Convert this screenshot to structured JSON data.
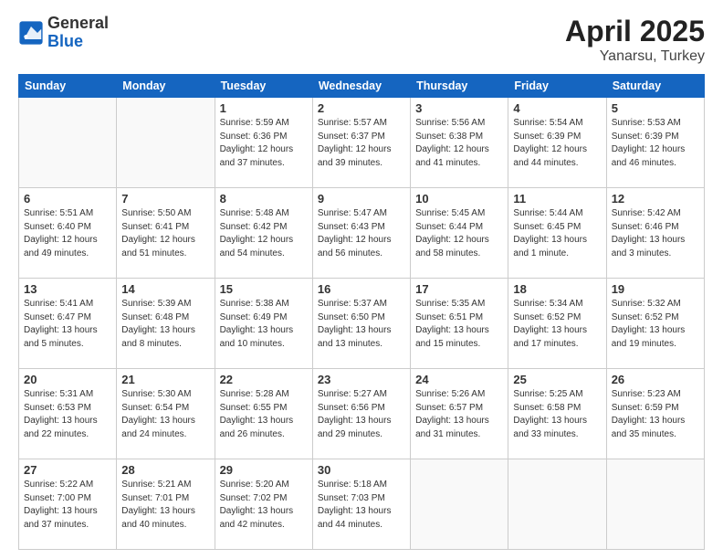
{
  "header": {
    "logo_general": "General",
    "logo_blue": "Blue",
    "title": "April 2025",
    "location": "Yanarsu, Turkey"
  },
  "days_of_week": [
    "Sunday",
    "Monday",
    "Tuesday",
    "Wednesday",
    "Thursday",
    "Friday",
    "Saturday"
  ],
  "weeks": [
    [
      {
        "day": "",
        "info": ""
      },
      {
        "day": "",
        "info": ""
      },
      {
        "day": "1",
        "info": "Sunrise: 5:59 AM\nSunset: 6:36 PM\nDaylight: 12 hours and 37 minutes."
      },
      {
        "day": "2",
        "info": "Sunrise: 5:57 AM\nSunset: 6:37 PM\nDaylight: 12 hours and 39 minutes."
      },
      {
        "day": "3",
        "info": "Sunrise: 5:56 AM\nSunset: 6:38 PM\nDaylight: 12 hours and 41 minutes."
      },
      {
        "day": "4",
        "info": "Sunrise: 5:54 AM\nSunset: 6:39 PM\nDaylight: 12 hours and 44 minutes."
      },
      {
        "day": "5",
        "info": "Sunrise: 5:53 AM\nSunset: 6:39 PM\nDaylight: 12 hours and 46 minutes."
      }
    ],
    [
      {
        "day": "6",
        "info": "Sunrise: 5:51 AM\nSunset: 6:40 PM\nDaylight: 12 hours and 49 minutes."
      },
      {
        "day": "7",
        "info": "Sunrise: 5:50 AM\nSunset: 6:41 PM\nDaylight: 12 hours and 51 minutes."
      },
      {
        "day": "8",
        "info": "Sunrise: 5:48 AM\nSunset: 6:42 PM\nDaylight: 12 hours and 54 minutes."
      },
      {
        "day": "9",
        "info": "Sunrise: 5:47 AM\nSunset: 6:43 PM\nDaylight: 12 hours and 56 minutes."
      },
      {
        "day": "10",
        "info": "Sunrise: 5:45 AM\nSunset: 6:44 PM\nDaylight: 12 hours and 58 minutes."
      },
      {
        "day": "11",
        "info": "Sunrise: 5:44 AM\nSunset: 6:45 PM\nDaylight: 13 hours and 1 minute."
      },
      {
        "day": "12",
        "info": "Sunrise: 5:42 AM\nSunset: 6:46 PM\nDaylight: 13 hours and 3 minutes."
      }
    ],
    [
      {
        "day": "13",
        "info": "Sunrise: 5:41 AM\nSunset: 6:47 PM\nDaylight: 13 hours and 5 minutes."
      },
      {
        "day": "14",
        "info": "Sunrise: 5:39 AM\nSunset: 6:48 PM\nDaylight: 13 hours and 8 minutes."
      },
      {
        "day": "15",
        "info": "Sunrise: 5:38 AM\nSunset: 6:49 PM\nDaylight: 13 hours and 10 minutes."
      },
      {
        "day": "16",
        "info": "Sunrise: 5:37 AM\nSunset: 6:50 PM\nDaylight: 13 hours and 13 minutes."
      },
      {
        "day": "17",
        "info": "Sunrise: 5:35 AM\nSunset: 6:51 PM\nDaylight: 13 hours and 15 minutes."
      },
      {
        "day": "18",
        "info": "Sunrise: 5:34 AM\nSunset: 6:52 PM\nDaylight: 13 hours and 17 minutes."
      },
      {
        "day": "19",
        "info": "Sunrise: 5:32 AM\nSunset: 6:52 PM\nDaylight: 13 hours and 19 minutes."
      }
    ],
    [
      {
        "day": "20",
        "info": "Sunrise: 5:31 AM\nSunset: 6:53 PM\nDaylight: 13 hours and 22 minutes."
      },
      {
        "day": "21",
        "info": "Sunrise: 5:30 AM\nSunset: 6:54 PM\nDaylight: 13 hours and 24 minutes."
      },
      {
        "day": "22",
        "info": "Sunrise: 5:28 AM\nSunset: 6:55 PM\nDaylight: 13 hours and 26 minutes."
      },
      {
        "day": "23",
        "info": "Sunrise: 5:27 AM\nSunset: 6:56 PM\nDaylight: 13 hours and 29 minutes."
      },
      {
        "day": "24",
        "info": "Sunrise: 5:26 AM\nSunset: 6:57 PM\nDaylight: 13 hours and 31 minutes."
      },
      {
        "day": "25",
        "info": "Sunrise: 5:25 AM\nSunset: 6:58 PM\nDaylight: 13 hours and 33 minutes."
      },
      {
        "day": "26",
        "info": "Sunrise: 5:23 AM\nSunset: 6:59 PM\nDaylight: 13 hours and 35 minutes."
      }
    ],
    [
      {
        "day": "27",
        "info": "Sunrise: 5:22 AM\nSunset: 7:00 PM\nDaylight: 13 hours and 37 minutes."
      },
      {
        "day": "28",
        "info": "Sunrise: 5:21 AM\nSunset: 7:01 PM\nDaylight: 13 hours and 40 minutes."
      },
      {
        "day": "29",
        "info": "Sunrise: 5:20 AM\nSunset: 7:02 PM\nDaylight: 13 hours and 42 minutes."
      },
      {
        "day": "30",
        "info": "Sunrise: 5:18 AM\nSunset: 7:03 PM\nDaylight: 13 hours and 44 minutes."
      },
      {
        "day": "",
        "info": ""
      },
      {
        "day": "",
        "info": ""
      },
      {
        "day": "",
        "info": ""
      }
    ]
  ]
}
